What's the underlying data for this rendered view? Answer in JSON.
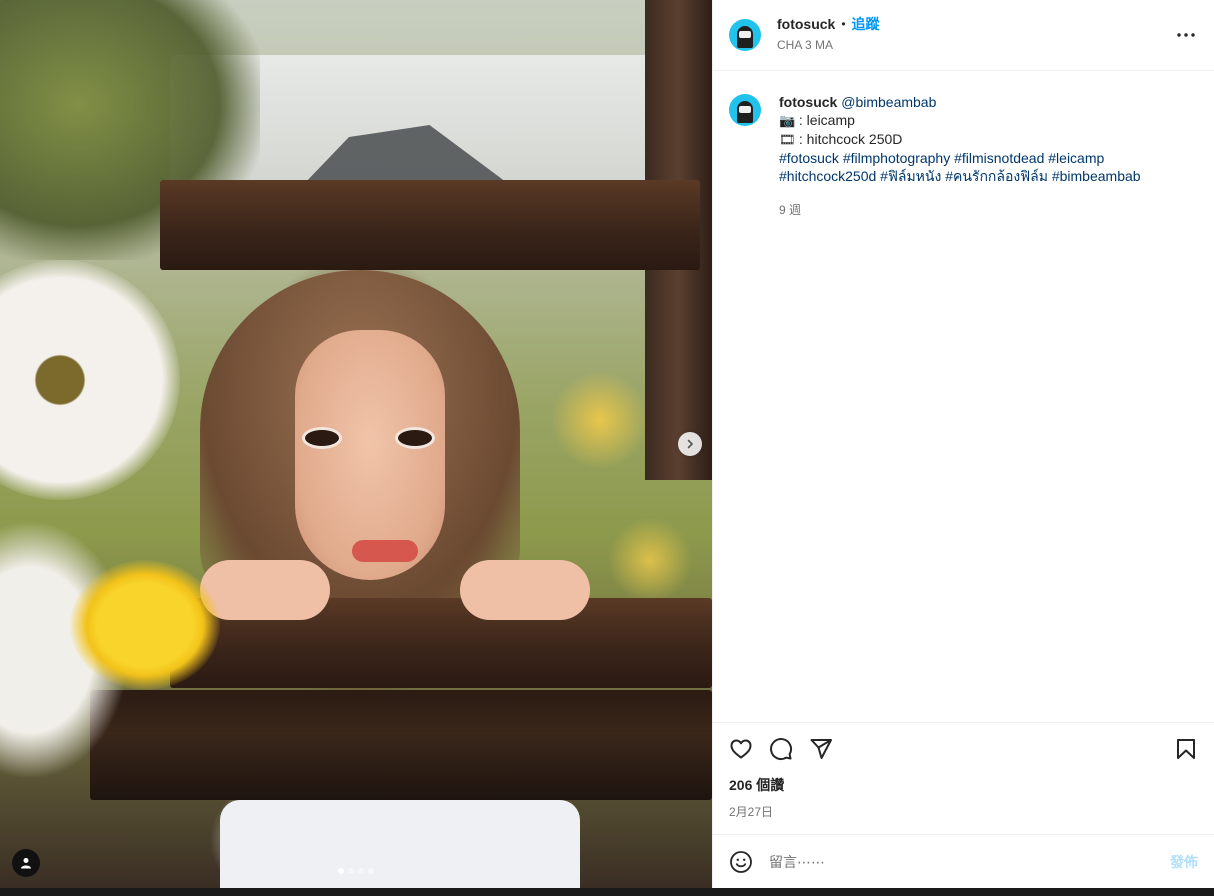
{
  "post": {
    "username": "fotosuck",
    "follow_label": "追蹤",
    "separator": "•",
    "location": "CHA 3 MA",
    "more_icon": "more-horizontal-icon"
  },
  "caption": {
    "username": "fotosuck",
    "mention": "@bimbeambab",
    "camera_emoji": "📷",
    "camera_text": ": leicamp",
    "film_emoji": "🎞",
    "film_text": ": hitchcock 250D",
    "hashtags_line1": "#fotosuck #filmphotography #filmisnotdead #leicamp",
    "hashtags_line2": "#hitchcock250d #ฟิล์มหนัง #คนรักกล้องฟิล์ม #bimbeambab",
    "time": "9 週"
  },
  "actions": {
    "like_icon": "heart-icon",
    "comment_icon": "comment-icon",
    "share_icon": "share-icon",
    "save_icon": "bookmark-icon",
    "likes": "206 個讚",
    "date": "2月27日"
  },
  "comment_box": {
    "placeholder": "留言⋯⋯",
    "post_label": "發佈",
    "emoji_icon": "smiley-icon"
  },
  "carousel": {
    "slide_count": 4,
    "current_slide": 1
  },
  "colors": {
    "accent": "#0095f6",
    "link": "#00376b",
    "avatar_bg": "#21c2ec",
    "post_disabled": "#b2dffc"
  }
}
